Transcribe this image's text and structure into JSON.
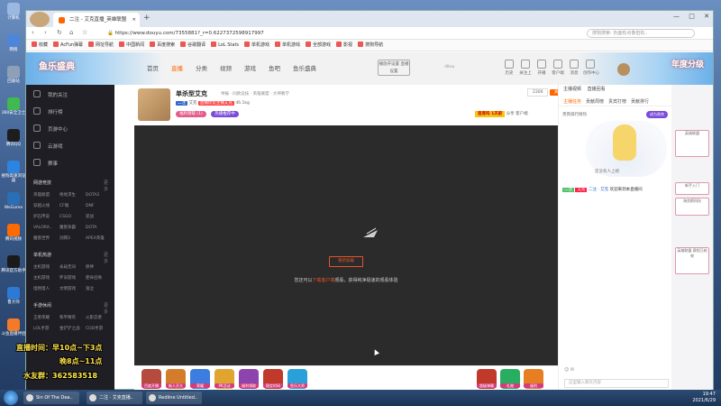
{
  "desktop_icons": [
    {
      "label": "计算机",
      "color": "#9bb8e0"
    },
    {
      "label": "网络",
      "color": "#4c86d8"
    },
    {
      "label": "回收站",
      "color": "#8ea0b8"
    },
    {
      "label": "360安全卫士",
      "color": "#3fb950"
    },
    {
      "label": "腾讯QQ",
      "color": "#1d1d1d"
    },
    {
      "label": "搜狗高速浏览器",
      "color": "#2d84e0"
    },
    {
      "label": "WeGame",
      "color": "#2a6fb5"
    },
    {
      "label": "腾讯视频",
      "color": "#ff6a00"
    },
    {
      "label": "腾讯官方助手",
      "color": "#1a1a1a"
    },
    {
      "label": "鲁大师",
      "color": "#2e79d4"
    },
    {
      "label": "斗鱼直播伴侣",
      "color": "#f27a28"
    }
  ],
  "browser": {
    "tab_title": "二注 - 艾克直播_英雄联盟",
    "url": "https://www.douyu.com/7355881?_r=0.6227372598917997",
    "search_placeholder": "搜狗搜索: 负面有点像但有..",
    "bookmarks": [
      "收藏",
      "AcFun弹幕",
      "网址导航",
      "中国新闻",
      "百度搜索",
      "谷歌翻译",
      "LoL Stats",
      "单机游戏",
      "单机游戏",
      "全部游戏",
      "影视",
      "搜狗导航"
    ]
  },
  "site": {
    "logo_text": "鱼乐盛典",
    "nav": [
      "首页",
      "直播",
      "分类",
      "视频",
      "游戏",
      "鱼吧",
      "鱼乐盛典"
    ],
    "nav_active": 1,
    "live_btn": "播放开设置 直播设置",
    "user_id": "dltou",
    "header_icons": [
      "历史",
      "关注上",
      "开播",
      "客户端",
      "消息",
      "创作中心"
    ],
    "hero_right": "年度分级"
  },
  "sidebar": {
    "items": [
      "我的关注",
      "排行榜",
      "页游中心",
      "云游戏",
      "赛事"
    ],
    "sections": [
      {
        "title": "网游竞技",
        "more": "更多",
        "games": [
          "英雄联盟",
          "绝地求生",
          "DOTA2",
          "穿越火线",
          "CF端",
          "DNF",
          "炉石传说",
          "CSGO",
          "逆战",
          "VALORA..",
          "魔兽争霸",
          "DOTA",
          "魔兽世界",
          "剑网3",
          "APEX英雄"
        ]
      },
      {
        "title": "单机热游",
        "more": "更多",
        "games": [
          "主机游戏",
          "永劫无间",
          "原神",
          "主机游戏",
          "怀旧游戏",
          "使命召唤",
          "怪物猎人",
          "文明游戏",
          "鬼泣"
        ]
      },
      {
        "title": "手游休闲",
        "more": "更多",
        "games": [
          "王者荣耀",
          "和平精英",
          "火影忍者",
          "LOL手游",
          "金铲铲之战",
          "COD手游"
        ]
      }
    ]
  },
  "room": {
    "name": "单杀型艾克",
    "meta": "举报 · 同款竞技 · 英雄联盟 · 大神教学",
    "tags": [
      "二注",
      "艾克"
    ],
    "badge1": "直播优化主播艾克",
    "hot": "46.1kg",
    "report": "举报",
    "badge_a": "福利领取 (1)",
    "badge_b": "热播推荐中",
    "follow_count": "2300",
    "follow_label": "关注",
    "rank": "首席吗 1天前",
    "share": "分享",
    "client": "客户端"
  },
  "player": {
    "retry": "重新加载",
    "hint_pre": "您还可以",
    "hint_link": "下载客户端",
    "hint_post": "观看，获得纯净极速的观看体验"
  },
  "gifts": [
    {
      "label": "百度开播",
      "color": "#b54a3f"
    },
    {
      "label": "新人开大",
      "color": "#d47c2b"
    },
    {
      "label": "荣耀",
      "color": "#3b7de0"
    },
    {
      "label": "PK活动",
      "color": "#e0a42f"
    },
    {
      "label": "福利领取",
      "color": "#8e44ad"
    },
    {
      "label": "稳定时间",
      "color": "#c0392b"
    },
    {
      "label": "鱼乐大师",
      "color": "#2aa0d8"
    }
  ],
  "gifts_right": [
    {
      "label": "超级弹幕",
      "color": "#c0392b"
    },
    {
      "label": "礼物",
      "color": "#27ae60"
    },
    {
      "label": "福利",
      "color": "#e67e22"
    }
  ],
  "chat": {
    "tabs": [
      "主播视频",
      "直播回看"
    ],
    "subtabs": [
      "主播任务",
      "贡献周榜",
      "贵宾打榜",
      "贡献排行"
    ],
    "guard_text": "贵宾排行榜热",
    "guard_btn": "成为贵宾",
    "guard_hint": "还没有人上榜",
    "msg_level": "二注",
    "msg_fan": "艾克",
    "msg_name": "二注 · 艾克",
    "msg_text": "欢迎来到本直播间",
    "input_placeholder": "这里输入聊天内容"
  },
  "ads": [
    "英雄联盟",
    "新手入门",
    "海克斯科技",
    "英雄联盟 赛程已结束"
  ],
  "overlay": {
    "line1": "直播时间：早10点~下3点",
    "line2": "晚8点~11点",
    "line3": "水友群：362583518"
  },
  "taskbar": {
    "items": [
      "Sin Of The Dea..",
      "二注 · 艾克直播..",
      "Redline Untitled.."
    ],
    "time": "19:47",
    "date": "2021/6/29"
  }
}
